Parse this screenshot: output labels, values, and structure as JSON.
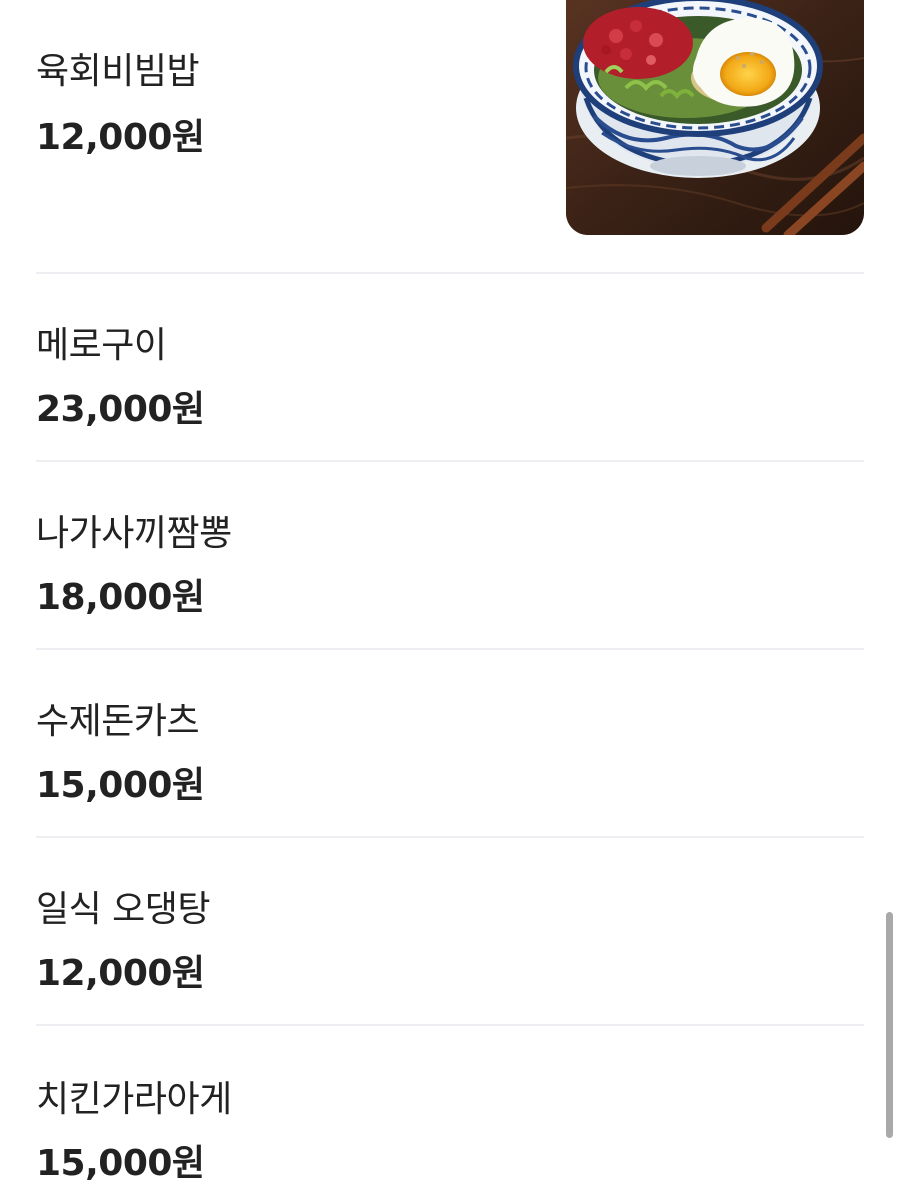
{
  "menu": {
    "items": [
      {
        "name": "육회비빔밥",
        "price": "12,000원",
        "has_image": true,
        "image_icon": "yukhoe-bibimbap-photo"
      },
      {
        "name": "메로구이",
        "price": "23,000원",
        "has_image": false
      },
      {
        "name": "나가사끼짬뽕",
        "price": "18,000원",
        "has_image": false
      },
      {
        "name": "수제돈카츠",
        "price": "15,000원",
        "has_image": false
      },
      {
        "name": "일식 오댕탕",
        "price": "12,000원",
        "has_image": false
      },
      {
        "name": "치킨가라아게",
        "price": "15,000원",
        "has_image": false
      }
    ]
  },
  "colors": {
    "text": "#222222",
    "divider": "#eceef1",
    "scrollbar": "#a9a9ab",
    "background": "#ffffff"
  }
}
